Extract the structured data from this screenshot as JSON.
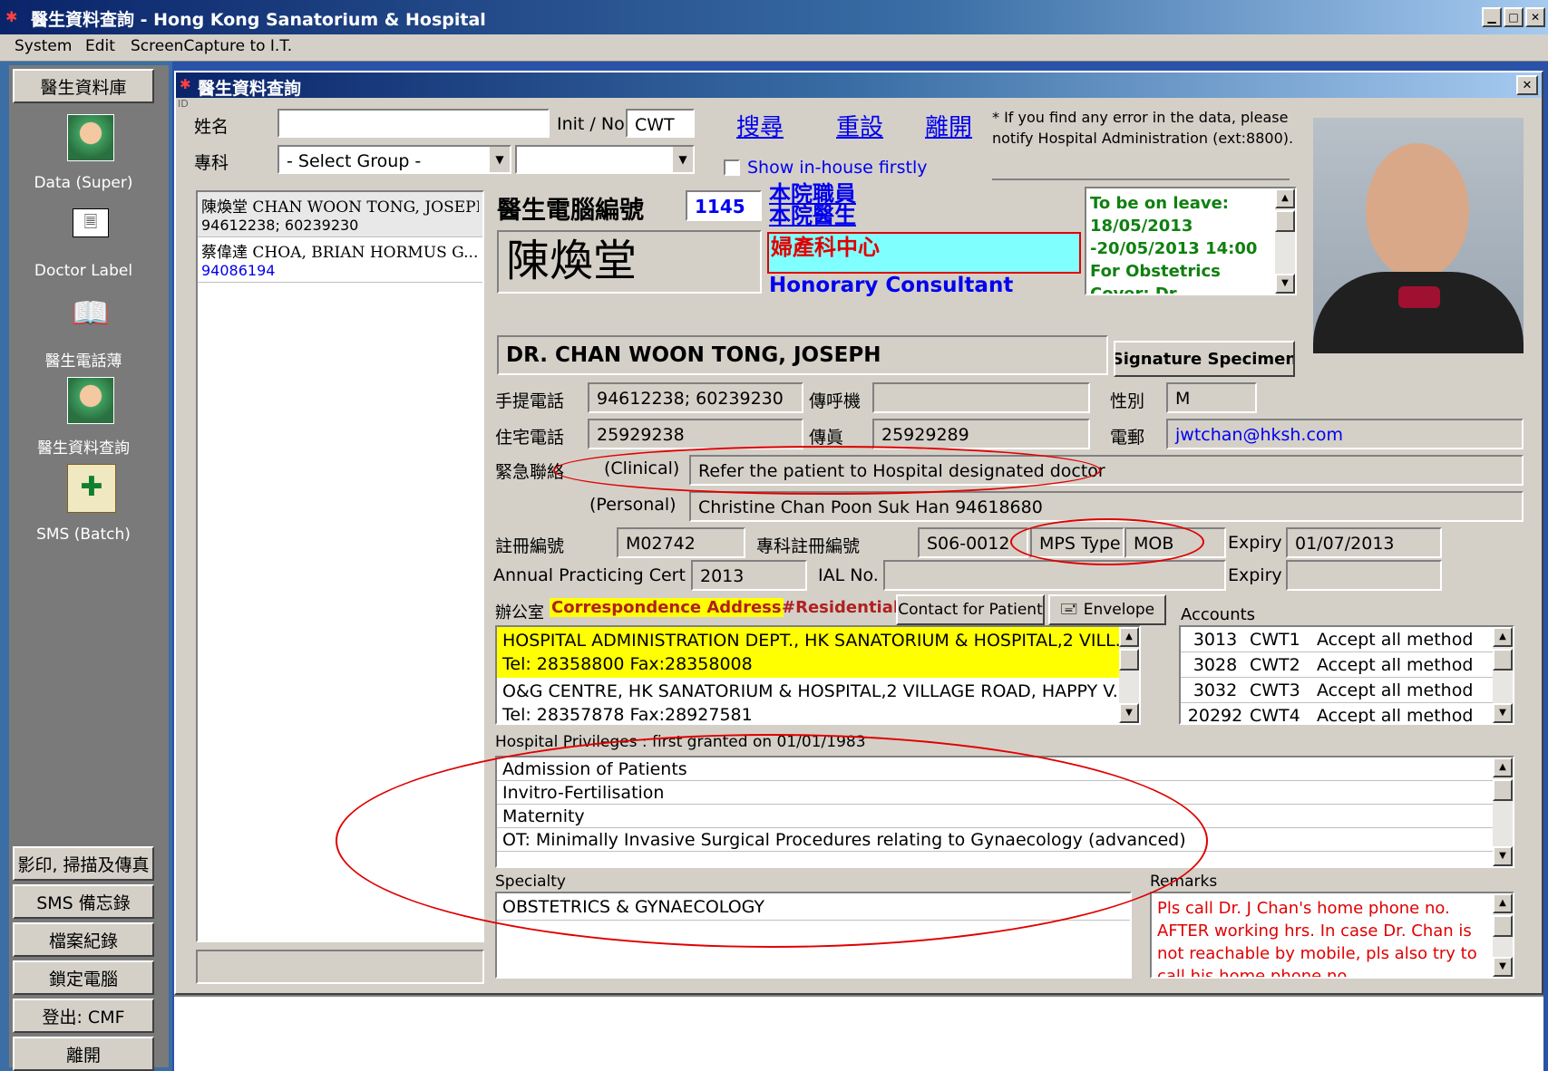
{
  "window": {
    "title": "醫生資料查詢 - Hong Kong Sanatorium & Hospital"
  },
  "menu": [
    "System",
    "Edit",
    "ScreenCapture to I.T."
  ],
  "sidebar": {
    "top_button": "醫生資料庫",
    "items": [
      {
        "label": "Data (Super)",
        "icon": "doctor-icon"
      },
      {
        "label": "Doctor Label",
        "icon": "label-icon"
      },
      {
        "label": "醫生電話薄",
        "icon": "phonebook-icon"
      },
      {
        "label": "醫生資料查詢",
        "icon": "doctor-icon"
      },
      {
        "label": "SMS (Batch)",
        "icon": "hospital-crest-icon"
      }
    ],
    "bottom_buttons": [
      "影印, 掃描及傳真",
      "SMS 備忘錄",
      "檔案紀錄",
      "鎖定電腦",
      "登出: CMF",
      "離開"
    ]
  },
  "inner": {
    "title": "醫生資料查詢",
    "id_label": "ID"
  },
  "search": {
    "name_label": "姓名",
    "name_value": "",
    "init_label": "Init / No",
    "init_value": "CWT",
    "dept_label": "專科",
    "group_value": "- Select Group -",
    "sub_value": "",
    "search_link": "搜尋",
    "reset_link": "重設",
    "exit_link": "離開",
    "notice": "* If you find any error in the data, please notify Hospital Administration (ext:8800).",
    "inhouse_label": "Show in-house firstly"
  },
  "results": [
    {
      "name": "陳煥堂 CHAN WOON TONG, JOSEPH",
      "phone": "94612238; 60239230"
    },
    {
      "name": "蔡偉達 CHOA, BRIAN HORMUS G...",
      "phone": "94086194"
    }
  ],
  "doctor": {
    "code_label": "醫生電腦編號",
    "code": "1145",
    "chinese_name": "陳煥堂",
    "status1": "本院職員",
    "status2": "本院醫生",
    "centre": "婦產科中心",
    "rank": "Honorary Consultant",
    "leave": "To be on leave: 18/05/2013 -20/05/2013 14:00 For Obstetrics Cover: Dr. ...",
    "english_name": "DR. CHAN WOON TONG, JOSEPH",
    "signature_button": "Signature Specimen",
    "mobile_label": "手提電話",
    "mobile": "94612238; 60239230",
    "pager_label": "傳呼機",
    "pager": "",
    "sex_label": "性別",
    "sex": "M",
    "home_label": "住宅電話",
    "home": "25929238",
    "fax_label": "傳眞",
    "fax": "25929289",
    "email_label": "電郵",
    "email": "jwtchan@hksh.com",
    "emergency_label": "緊急聯絡",
    "clinical_label": "(Clinical)",
    "clinical": "Refer the patient to Hospital designated doctor",
    "personal_label": "(Personal)",
    "personal": "Christine Chan Poon Suk Han 94618680",
    "reg_label": "註冊編號",
    "reg": "M02742",
    "spec_reg_label": "專科註冊編號",
    "spec_reg": "S06-0012",
    "mps_label": "MPS Type",
    "mps": "MOB",
    "expiry_label": "Expiry",
    "expiry1": "01/07/2013",
    "apc_label": "Annual Practicing Cert",
    "apc": "2013",
    "ial_label": "IAL No.",
    "ial": "",
    "expiry2": ""
  },
  "address": {
    "office_label": "辦公室",
    "corr_label": "Correspondence Address",
    "res_label": "#Residential",
    "contact_button": "Contact for Patient",
    "envelope_button": "Envelope",
    "entries": [
      {
        "line1": "HOSPITAL ADMINISTRATION DEPT., HK SANATORIUM & HOSPITAL,2 VILL...",
        "line2": "Tel: 28358800 Fax:28358008"
      },
      {
        "line1": "O&G CENTRE, HK SANATORIUM & HOSPITAL,2 VILLAGE ROAD, HAPPY V...",
        "line2": "Tel: 28357878 Fax:28927581"
      }
    ]
  },
  "accounts": {
    "label": "Accounts",
    "rows": [
      {
        "no": "3013",
        "code": "CWT1",
        "method": "Accept all method"
      },
      {
        "no": "3028",
        "code": "CWT2",
        "method": "Accept all method"
      },
      {
        "no": "3032",
        "code": "CWT3",
        "method": "Accept all method"
      },
      {
        "no": "20292",
        "code": "CWT4",
        "method": "Accept all method"
      }
    ]
  },
  "privileges": {
    "label": "Hospital Privileges : first granted on 01/01/1983",
    "items": [
      "Admission of Patients",
      "Invitro-Fertilisation",
      "Maternity",
      "OT: Minimally Invasive Surgical Procedures relating to Gynaecology (advanced)"
    ]
  },
  "specialty": {
    "label": "Specialty",
    "value": "OBSTETRICS & GYNAECOLOGY"
  },
  "remarks": {
    "label": "Remarks",
    "value": "Pls call Dr. J Chan's home phone no. AFTER working hrs. In case Dr. Chan is not reachable by mobile, pls also try to call his home phone no."
  },
  "colors": {
    "titlebar": "#0a246a",
    "highlight": "#ffff00",
    "cyan": "#80ffff",
    "link": "#0000ee",
    "green": "#008000",
    "red": "#e00000"
  }
}
